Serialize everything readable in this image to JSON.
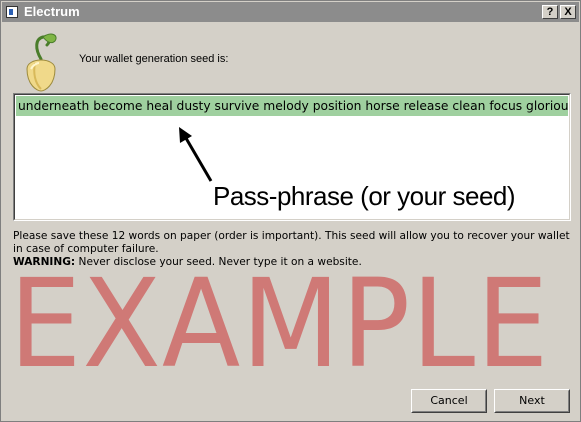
{
  "window": {
    "title": "Electrum",
    "help_label": "?",
    "close_label": "X"
  },
  "main": {
    "heading": "Your wallet generation seed is:",
    "seed": "underneath become heal dusty survive melody position horse release clean focus glorious",
    "annotation": "Pass-phrase (or your seed)",
    "info": "Please save these 12 words on paper (order is important). This seed will allow you to recover your wallet in case of computer failure.",
    "warning_label": "WARNING:",
    "warning_text": " Never disclose your seed. Never type it on a website.",
    "watermark": "EXAMPLE"
  },
  "buttons": {
    "cancel": "Cancel",
    "next": "Next"
  },
  "icons": {
    "app": "electrum-window-icon",
    "logo": "seedling-icon",
    "arrow": "arrow-icon"
  },
  "colors": {
    "seed_highlight": "#9fd09f",
    "watermark": "#cc4444",
    "titlebar": "#8c8c8c"
  }
}
